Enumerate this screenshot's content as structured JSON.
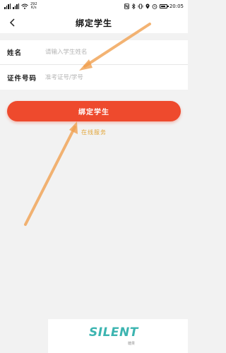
{
  "status_bar": {
    "network_speed_value": "292",
    "network_speed_unit": "K/s",
    "time": "20:05"
  },
  "nav": {
    "title": "绑定学生"
  },
  "form": {
    "name_label": "姓名",
    "name_placeholder": "请输入学生姓名",
    "id_label": "证件号码",
    "id_placeholder": "准考证号/学号"
  },
  "bind_button_label": "绑定学生",
  "online_service_label": "在线服务",
  "watermark": {
    "logo_text": "SILENT",
    "sub_text": "糖果"
  },
  "colors": {
    "accent_button": "#ee4a2d",
    "link_text": "#e2a63a",
    "annotation_arrow": "#f0a050",
    "watermark": "#3cb4b0"
  }
}
